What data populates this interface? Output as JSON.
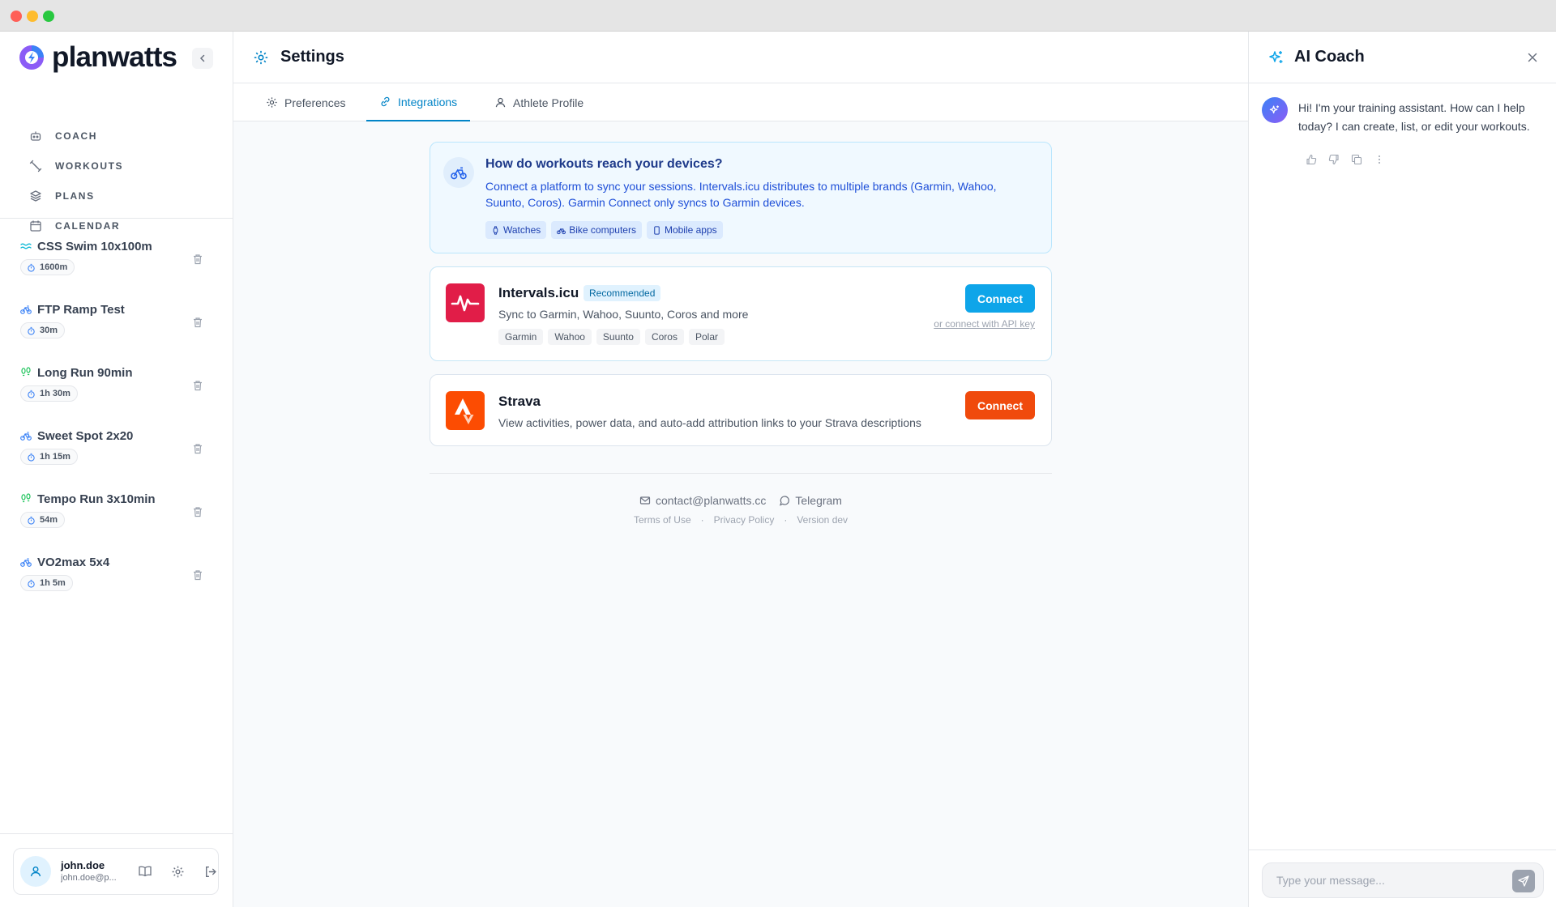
{
  "app": {
    "brand": "planwatts"
  },
  "sidebar": {
    "nav": [
      {
        "label": "COACH",
        "icon": "robot-icon"
      },
      {
        "label": "WORKOUTS",
        "icon": "dumbbell-icon"
      },
      {
        "label": "PLANS",
        "icon": "layers-icon"
      },
      {
        "label": "CALENDAR",
        "icon": "calendar-icon"
      }
    ],
    "workouts": [
      {
        "name": "CSS Swim 10x100m",
        "duration": "1600m",
        "sport": "swim",
        "color": "#06b6d4"
      },
      {
        "name": "FTP Ramp Test",
        "duration": "30m",
        "sport": "bike",
        "color": "#3b82f6"
      },
      {
        "name": "Long Run 90min",
        "duration": "1h 30m",
        "sport": "run",
        "color": "#22c55e"
      },
      {
        "name": "Sweet Spot 2x20",
        "duration": "1h 15m",
        "sport": "bike",
        "color": "#3b82f6"
      },
      {
        "name": "Tempo Run 3x10min",
        "duration": "54m",
        "sport": "run",
        "color": "#22c55e"
      },
      {
        "name": "VO2max 5x4",
        "duration": "1h 5m",
        "sport": "bike",
        "color": "#3b82f6"
      }
    ],
    "user": {
      "name": "john.doe",
      "email": "john.doe@p..."
    }
  },
  "header": {
    "title": "Settings"
  },
  "tabs": [
    {
      "label": "Preferences",
      "icon": "gear-icon",
      "active": false
    },
    {
      "label": "Integrations",
      "icon": "link-icon",
      "active": true
    },
    {
      "label": "Athlete Profile",
      "icon": "user-icon",
      "active": false
    }
  ],
  "info": {
    "title": "How do workouts reach your devices?",
    "description": "Connect a platform to sync your sessions. Intervals.icu distributes to multiple brands (Garmin, Wahoo, Suunto, Coros). Garmin Connect only syncs to Garmin devices.",
    "chips": [
      "Watches",
      "Bike computers",
      "Mobile apps"
    ]
  },
  "integrations": {
    "intervals": {
      "name": "Intervals.icu",
      "badge": "Recommended",
      "description": "Sync to Garmin, Wahoo, Suunto, Coros and more",
      "brands": [
        "Garmin",
        "Wahoo",
        "Suunto",
        "Coros",
        "Polar"
      ],
      "connect_label": "Connect",
      "api_link": "or connect with API key",
      "color": "#e11d48"
    },
    "strava": {
      "name": "Strava",
      "description": "View activities, power data, and auto-add attribution links to your Strava descriptions",
      "connect_label": "Connect",
      "color": "#fc4c02"
    }
  },
  "footer": {
    "email": "contact@planwatts.cc",
    "telegram": "Telegram",
    "terms": "Terms of Use",
    "privacy": "Privacy Policy",
    "version": "Version dev",
    "separator": "·"
  },
  "coach": {
    "title": "AI Coach",
    "message": "Hi! I'm your training assistant. How can I help today? I can create, list, or edit your workouts.",
    "input_placeholder": "Type your message..."
  },
  "colors": {
    "accent": "#0284c7",
    "brand_blue": "#3b82f6"
  }
}
